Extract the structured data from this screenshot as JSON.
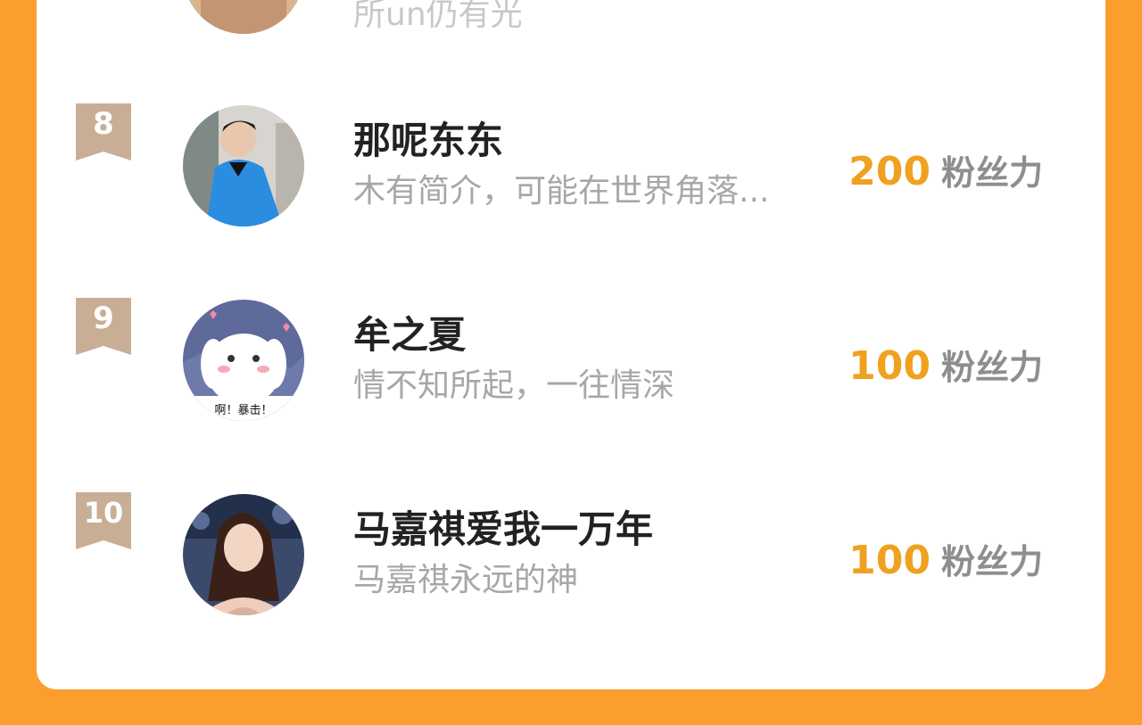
{
  "ranking": {
    "colors": {
      "background": "#FB9E2E",
      "card": "#ffffff",
      "badge": "#C9AE96",
      "power_value": "#F0A120",
      "name": "#222222",
      "bio": "#a7a7a7"
    },
    "partial_row": {
      "bio": "所un仍有光"
    },
    "rows": [
      {
        "rank": "8",
        "name": "那呢东东",
        "bio": "木有简介，可能在世界角落...",
        "power_value": "200",
        "power_unit": "粉丝力",
        "avatar_icon": "man-blue-shirt-avatar"
      },
      {
        "rank": "9",
        "name": "牟之夏",
        "bio": "情不知所起，一往情深",
        "power_value": "100",
        "power_unit": "粉丝力",
        "avatar_icon": "cartoon-rabbit-avatar",
        "avatar_caption": "啊！暴击！"
      },
      {
        "rank": "10",
        "name": "马嘉祺爱我一万年",
        "bio": "马嘉祺永远的神",
        "power_value": "100",
        "power_unit": "粉丝力",
        "avatar_icon": "woman-portrait-avatar"
      }
    ]
  }
}
